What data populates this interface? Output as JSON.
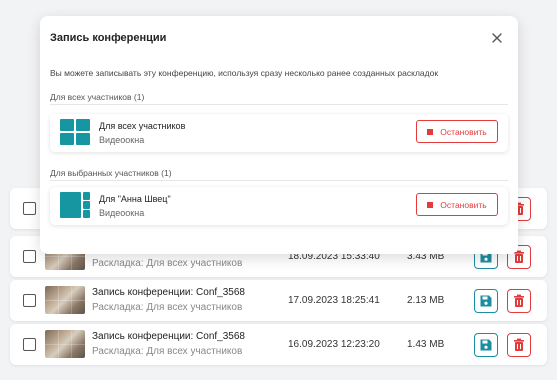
{
  "modal": {
    "title": "Запись конференции",
    "description": "Вы можете записывать эту конференцию, используя сразу несколько ранее созданных раскладок",
    "sections": [
      {
        "label": "Для всех участников (1)",
        "item": {
          "name": "Для всех участников",
          "sub": "Видеоокна",
          "button": "Остановить",
          "icon": "grid-2x2-layout-icon"
        }
      },
      {
        "label": "Для выбранных участников (1)",
        "item": {
          "name": "Для \"Анна Швец\"",
          "sub": "Видеоокна",
          "button": "Остановить",
          "icon": "speaker-layout-icon"
        }
      }
    ]
  },
  "recordings": [
    {
      "title": "",
      "layout": "",
      "date": "",
      "size": ""
    },
    {
      "title": "",
      "layout": "Раскладка: Для всех участников",
      "date": "18.09.2023 15:33:40",
      "size": "3.43 MB"
    },
    {
      "title": "Запись конференции: Conf_3568",
      "layout": "Раскладка: Для всех участников",
      "date": "17.09.2023 18:25:41",
      "size": "2.13 MB"
    },
    {
      "title": "Запись конференции: Conf_3568",
      "layout": "Раскладка: Для всех участников",
      "date": "16.09.2023 12:23:20",
      "size": "1.43 MB"
    }
  ],
  "colors": {
    "accent": "#1b8ea1",
    "danger": "#e23c3c",
    "layout_tile": "#1596a0"
  }
}
